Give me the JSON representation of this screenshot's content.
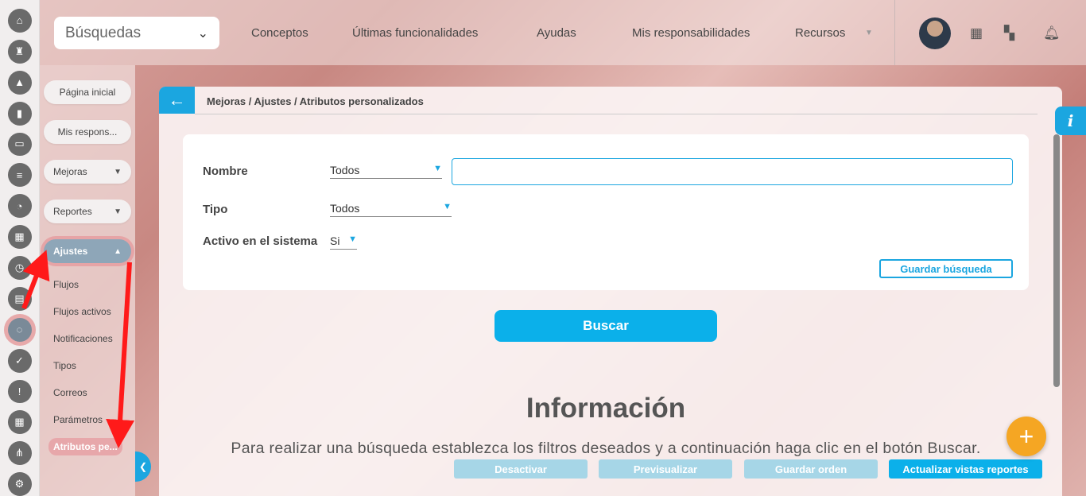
{
  "header": {
    "search_select": "Búsquedas",
    "nav": [
      "Conceptos",
      "Últimas funcionalidades",
      "Ayudas",
      "Mis responsabilidades",
      "Recursos"
    ]
  },
  "sidebar": {
    "pills": {
      "home": "Página inicial",
      "responsibilities": "Mis respons...",
      "improvements": "Mejoras",
      "reports": "Reportes",
      "settings": "Ajustes"
    },
    "sub_items": [
      "Flujos",
      "Flujos activos",
      "Notificaciones",
      "Tipos",
      "Correos",
      "Parámetros",
      "Atributos pe..."
    ]
  },
  "breadcrumb": "Mejoras / Ajustes / Atributos personalizados",
  "filters": {
    "name_label": "Nombre",
    "name_select": "Todos",
    "name_text": "",
    "type_label": "Tipo",
    "type_select": "Todos",
    "active_label": "Activo en el sistema",
    "active_select": "Si",
    "save_search": "Guardar búsqueda"
  },
  "search_button": "Buscar",
  "info": {
    "title": "Información",
    "text": "Para realizar una búsqueda establezca los filtros deseados y a continuación haga clic en el botón Buscar."
  },
  "bottom_buttons": {
    "deactivate": "Desactivar",
    "preview": "Previsualizar",
    "save_order": "Guardar orden",
    "update_views": "Actualizar vistas reportes"
  },
  "icons": {
    "info": "i",
    "fab": "+"
  },
  "colors": {
    "accent": "#1ba6e0",
    "fab": "#f5a623",
    "annotation": "#ff1a1a"
  }
}
